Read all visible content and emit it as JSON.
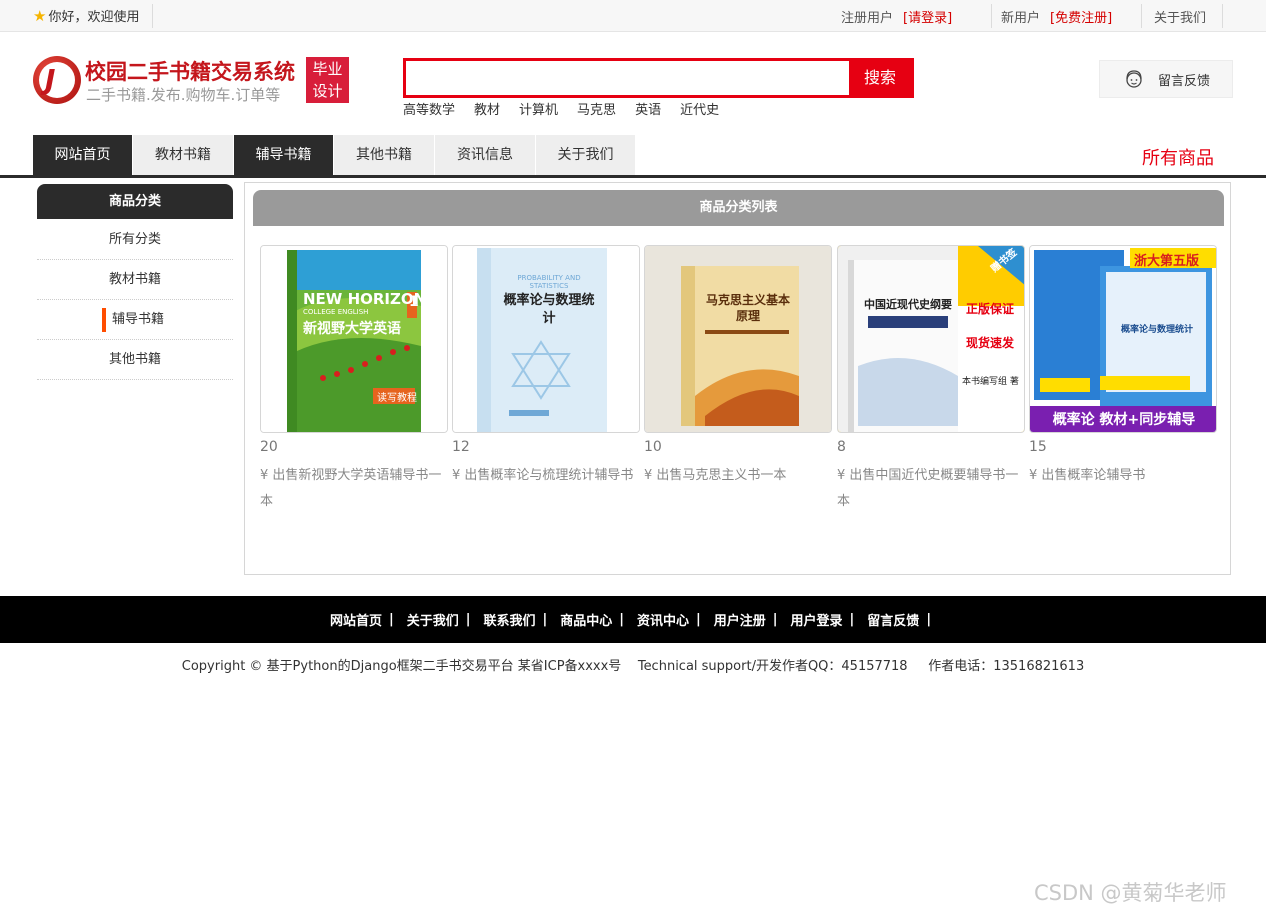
{
  "topbar": {
    "welcome": "你好，欢迎使用",
    "registered_label": "注册用户",
    "login_link": "[请登录]",
    "new_user_label": "新用户",
    "register_link": "[免费注册]",
    "about_link": "关于我们"
  },
  "header": {
    "site_title": "校园二手书籍交易系统",
    "site_subtitle": "二手书籍.发布.购物车.订单等",
    "badge_line1": "毕业",
    "badge_line2": "设计",
    "search_placeholder": "",
    "search_button": "搜索",
    "hotwords": [
      "高等数学",
      "教材",
      "计算机",
      "马克思",
      "英语",
      "近代史"
    ],
    "feedback": "留言反馈"
  },
  "nav": {
    "items": [
      "网站首页",
      "教材书籍",
      "辅导书籍",
      "其他书籍",
      "资讯信息",
      "关于我们"
    ],
    "all_goods": "所有商品"
  },
  "sidebar": {
    "title": "商品分类",
    "items": [
      "所有分类",
      "教材书籍",
      "辅导书籍",
      "其他书籍"
    ],
    "active_index": 2
  },
  "panel": {
    "title": "商品分类列表",
    "products": [
      {
        "price": "20",
        "title": "¥ 出售新视野大学英语辅导书一本",
        "cover_en": "NEW HORIZON",
        "cover_sub": "COLLEGE ENGLISH",
        "cover_cn": "新视野大学英语",
        "cover_tag": "读写教程",
        "cover_num": "1"
      },
      {
        "price": "12",
        "title": "¥ 出售概率论与梳理统计辅导书",
        "cover_en": "PROBABILITY AND STATISTICS",
        "cover_cn": "概率论与数理统计"
      },
      {
        "price": "10",
        "title": "¥ 出售马克思主义书一本",
        "cover_cn": "马克思主义基本原理"
      },
      {
        "price": "8",
        "title": "¥ 出售中国近代史概要辅导书一本",
        "cover_cn": "中国近现代史纲要",
        "cover_tag1": "正版保证",
        "cover_tag2": "现货速发",
        "cover_author": "本书编写组 著",
        "cover_corner": "赠书签"
      },
      {
        "price": "15",
        "title": "¥ 出售概率论辅导书",
        "cover_banner": "浙大第五版",
        "cover_cn": "概率论与数理统计",
        "cover_bottom": "概率论 教材+同步辅导"
      }
    ]
  },
  "footer": {
    "links": [
      "网站首页",
      "关于我们",
      "联系我们",
      "商品中心",
      "资讯中心",
      "用户注册",
      "用户登录",
      "留言反馈"
    ],
    "copyright": "Copyright © 基于Python的Django框架二手书交易平台 某省ICP备xxxx号    Technical support/开发作者QQ：45157718     作者电话：13516821613"
  },
  "watermark": "CSDN @黄菊华老师",
  "colors": {
    "accent": "#e60012",
    "dark": "#2b2b2b",
    "panel_head": "#9a9a9a"
  }
}
